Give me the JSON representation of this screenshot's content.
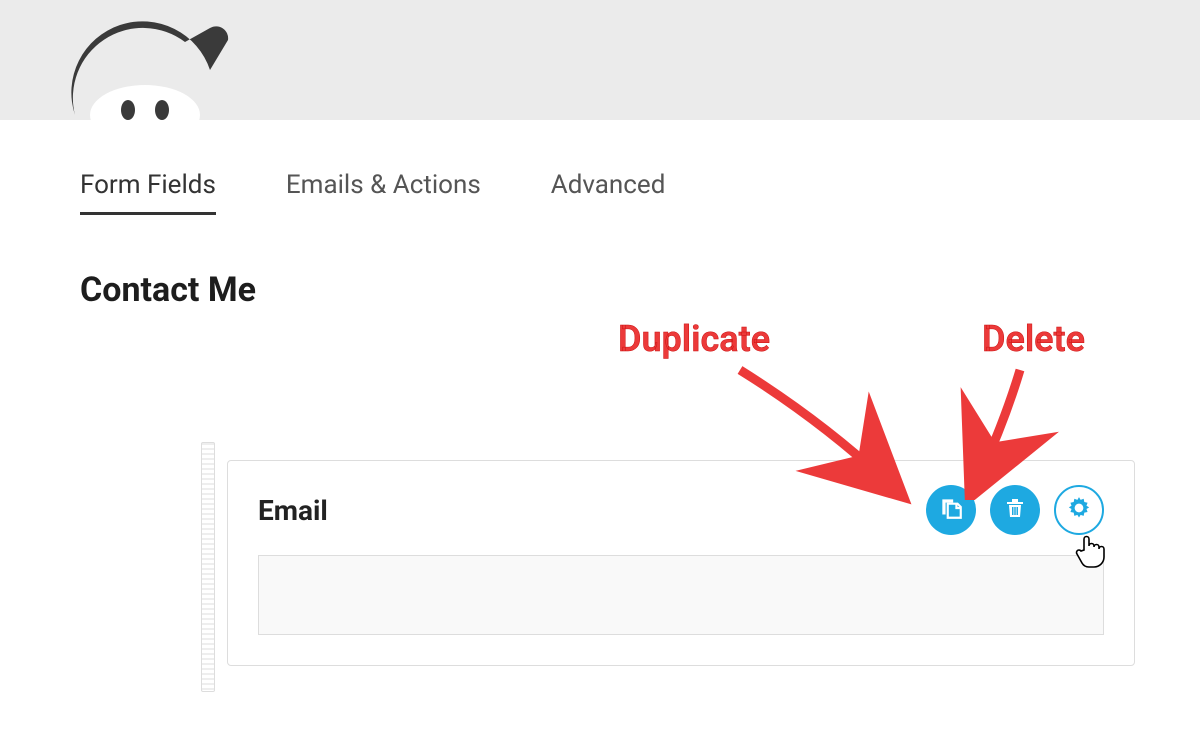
{
  "tabs": {
    "form_fields": "Form Fields",
    "emails_actions": "Emails & Actions",
    "advanced": "Advanced"
  },
  "form": {
    "title": "Contact Me"
  },
  "field": {
    "label": "Email",
    "value": ""
  },
  "annotations": {
    "duplicate": "Duplicate",
    "delete": "Delete"
  },
  "colors": {
    "accent": "#1ea9e1",
    "annotation": "#ec3a3a"
  }
}
